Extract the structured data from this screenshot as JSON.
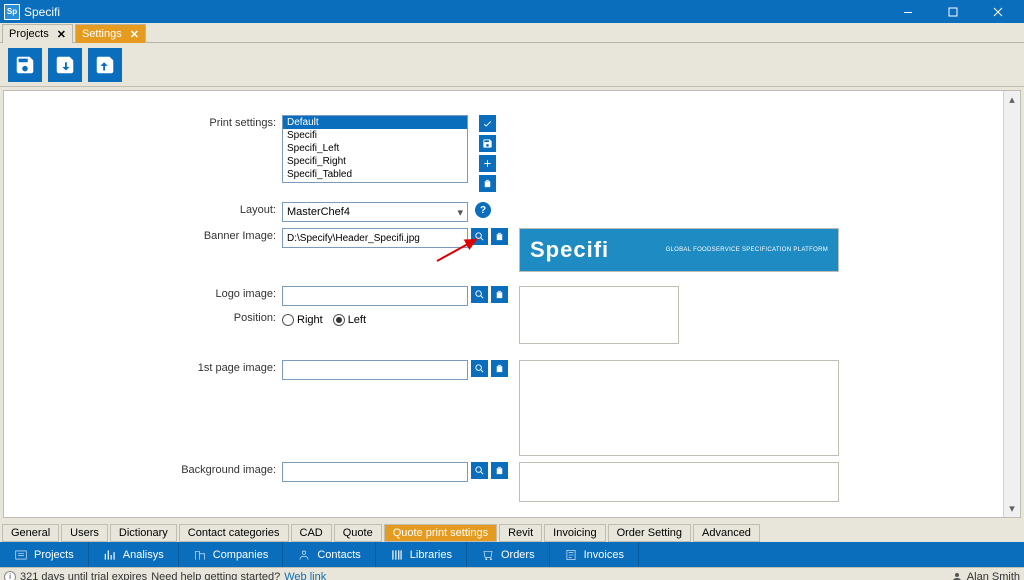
{
  "titlebar": {
    "app": "Specifi",
    "icon_label": "Sp"
  },
  "tabs": [
    {
      "label": "Projects",
      "active": false
    },
    {
      "label": "Settings",
      "active": true
    }
  ],
  "form": {
    "print_settings_label": "Print settings:",
    "print_settings_items": [
      "Default",
      "Specifi",
      "Specifi_Left",
      "Specifi_Right",
      "Specifi_Tabled"
    ],
    "layout_label": "Layout:",
    "layout_value": "MasterChef4",
    "banner_label": "Banner Image:",
    "banner_value": "D:\\Specify\\Header_Specifi.jpg",
    "banner_brand": "Specifi",
    "banner_tag": "GLOBAL FOODSERVICE SPECIFICATION PLATFORM",
    "logo_label": "Logo image:",
    "logo_value": "",
    "position_label": "Position:",
    "position_right": "Right",
    "position_left": "Left",
    "firstpage_label": "1st page image:",
    "firstpage_value": "",
    "background_label": "Background image:",
    "background_value": ""
  },
  "bottom_tabs": [
    "General",
    "Users",
    "Dictionary",
    "Contact categories",
    "CAD",
    "Quote",
    "Quote print settings",
    "Revit",
    "Invoicing",
    "Order Setting",
    "Advanced"
  ],
  "bottom_active": "Quote print settings",
  "nav": [
    "Projects",
    "Analisys",
    "Companies",
    "Contacts",
    "Libraries",
    "Orders",
    "Invoices"
  ],
  "status": {
    "trial": "321 days until trial expires",
    "help": "Need help getting started?",
    "link": "Web link",
    "user": "Alan Smith"
  }
}
